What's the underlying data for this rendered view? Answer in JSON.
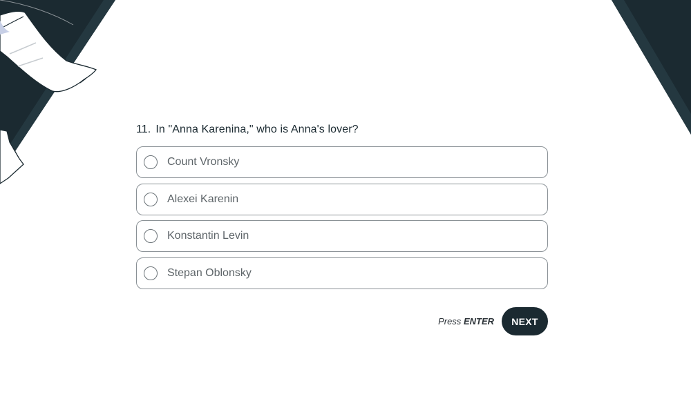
{
  "question": {
    "number": "11.",
    "text": "In \"Anna Karenina,\" who is Anna's lover?"
  },
  "options": [
    {
      "label": "Count Vronsky"
    },
    {
      "label": "Alexei Karenin"
    },
    {
      "label": "Konstantin Levin"
    },
    {
      "label": "Stepan Oblonsky"
    }
  ],
  "footer": {
    "hint_prefix": "Press",
    "hint_key": "ENTER",
    "next_label": "NEXT"
  },
  "colors": {
    "accent": "#1b2a31",
    "background": "#ffffff",
    "option_border": "#8a9196",
    "option_text": "#5d6468"
  },
  "icons": {
    "decoration_left": "paper-scroll-illustration",
    "decoration_right": "dark-diagonal-shape"
  }
}
